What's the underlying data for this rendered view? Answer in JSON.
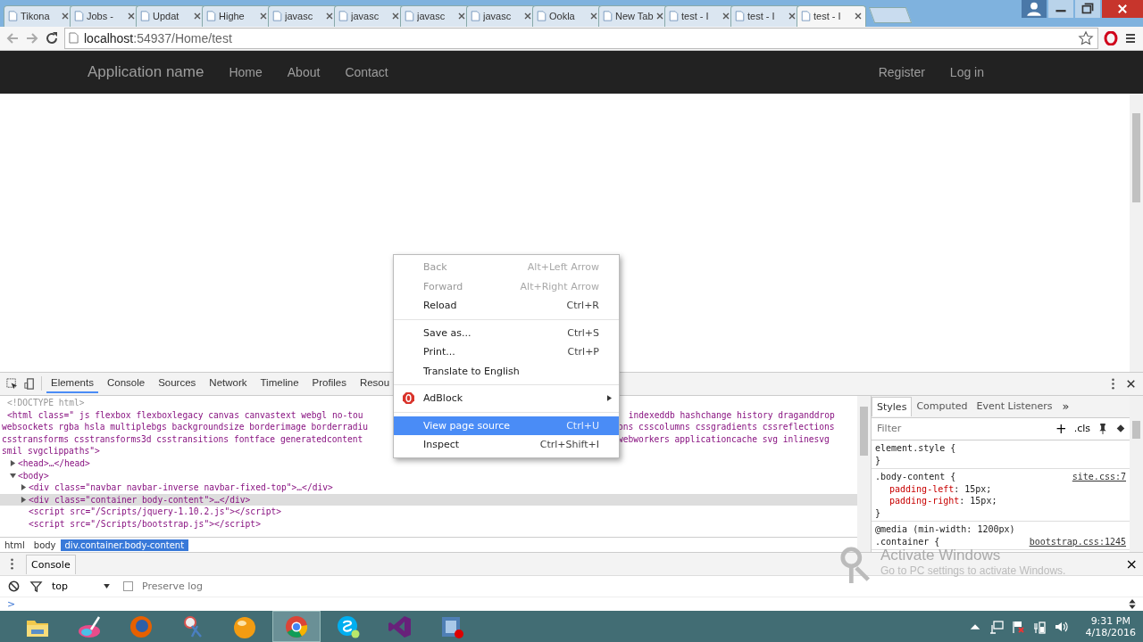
{
  "browser": {
    "tabs": [
      {
        "label": "Tikona",
        "selected": false
      },
      {
        "label": "Jobs -",
        "selected": false
      },
      {
        "label": "Updat",
        "selected": false
      },
      {
        "label": "Highe",
        "selected": false
      },
      {
        "label": "javasc",
        "selected": false
      },
      {
        "label": "javasc",
        "selected": false
      },
      {
        "label": "javasc",
        "selected": false
      },
      {
        "label": "javasc",
        "selected": false
      },
      {
        "label": "Ookla",
        "selected": false
      },
      {
        "label": "New Tab",
        "selected": false
      },
      {
        "label": "test - I",
        "selected": false
      },
      {
        "label": "test - I",
        "selected": false
      },
      {
        "label": "test - I",
        "selected": true
      }
    ],
    "url_host": "localhost",
    "url_path": ":54937/Home/test"
  },
  "page": {
    "brand": "Application name",
    "nav_left": [
      "Home",
      "About",
      "Contact"
    ],
    "nav_right": [
      "Register",
      "Log in"
    ]
  },
  "devtools": {
    "tabs": [
      {
        "label": "Elements",
        "selected": true
      },
      {
        "label": "Console",
        "selected": false
      },
      {
        "label": "Sources",
        "selected": false
      },
      {
        "label": "Network",
        "selected": false
      },
      {
        "label": "Timeline",
        "selected": false
      },
      {
        "label": "Profiles",
        "selected": false
      },
      {
        "label": "Resou",
        "selected": false
      }
    ],
    "dom_tree": [
      {
        "kind": "doctype",
        "selected": false,
        "lines": [
          {
            "text": "<!DOCTYPE html>"
          }
        ]
      },
      {
        "kind": "element",
        "selected": false,
        "lines": [
          {
            "text": "<html class=\" js flexbox flexboxlegacy canvas canvastext webgl no-tou",
            "right": " indexeddb hashchange history draganddrop"
          },
          {
            "text": "websockets rgba hsla multiplebgs backgroundsize borderimage borderradiu",
            "right": "ons csscolumns cssgradients cssreflections"
          },
          {
            "text": "csstransforms csstransforms3d csstransitions fontface generatedcontent",
            "right": "webworkers applicationcache svg inlinesvg"
          },
          {
            "text": "smil svgclippaths\">"
          }
        ],
        "children": [
          {
            "kind": "element",
            "selected": false,
            "expanded": false,
            "lines": [
              {
                "text": "<head>…</head>"
              }
            ]
          },
          {
            "kind": "element",
            "selected": false,
            "expanded": true,
            "lines": [
              {
                "text": "<body>"
              }
            ],
            "children": [
              {
                "kind": "element",
                "selected": false,
                "expanded": false,
                "lines": [
                  {
                    "text": "<div class=\"navbar navbar-inverse navbar-fixed-top\">…</div>"
                  }
                ]
              },
              {
                "kind": "element",
                "selected": true,
                "expanded": false,
                "lines": [
                  {
                    "text": "<div class=\"container body-content\">…</div>"
                  }
                ]
              },
              {
                "kind": "element",
                "selected": false,
                "lines": [
                  {
                    "text": "<script src=\"/Scripts/jquery-1.10.2.js\"></script>"
                  }
                ]
              },
              {
                "kind": "element",
                "selected": false,
                "lines": [
                  {
                    "text": "<script src=\"/Scripts/bootstrap.js\"></script>"
                  }
                ]
              }
            ]
          }
        ]
      }
    ],
    "breadcrumbs": [
      {
        "label": "html",
        "selected": false
      },
      {
        "label": "body",
        "selected": false
      },
      {
        "label": "div.container.body-content",
        "selected": true
      }
    ],
    "side_tabs": [
      {
        "label": "Styles",
        "selected": true
      },
      {
        "label": "Computed",
        "selected": false
      },
      {
        "label": "Event Listeners",
        "selected": false
      }
    ],
    "side_more": "»",
    "filter": {
      "placeholder": "Filter"
    },
    "add": "+",
    "cls": ".cls",
    "rules": [
      {
        "selector": "element.style {",
        "close": "}"
      },
      {
        "selector": ".body-content {",
        "source": "site.css:7",
        "close": "}",
        "declarations": [
          {
            "property": "padding-left",
            "value": ": 15px;"
          },
          {
            "property": "padding-right",
            "value": ": 15px;"
          }
        ]
      },
      {
        "media": "@media (min-width: 1200px)",
        "selector": ".container {",
        "source": "bootstrap.css:1245"
      }
    ],
    "drawer_tab": "Console",
    "close": "×",
    "context": "top",
    "preserve_log": {
      "label": "Preserve log",
      "checked": false
    },
    "prompt": ">"
  },
  "context_menu": [
    {
      "kind": "item",
      "label": "Back",
      "shortcut": "Alt+Left Arrow",
      "disabled": true,
      "selected": false
    },
    {
      "kind": "item",
      "label": "Forward",
      "shortcut": "Alt+Right Arrow",
      "disabled": true,
      "selected": false
    },
    {
      "kind": "item",
      "label": "Reload",
      "shortcut": "Ctrl+R",
      "disabled": false,
      "selected": false
    },
    {
      "kind": "separator"
    },
    {
      "kind": "item",
      "label": "Save as...",
      "shortcut": "Ctrl+S",
      "disabled": false,
      "selected": false
    },
    {
      "kind": "item",
      "label": "Print...",
      "shortcut": "Ctrl+P",
      "disabled": false,
      "selected": false
    },
    {
      "kind": "item",
      "label": "Translate to English",
      "disabled": false,
      "selected": false
    },
    {
      "kind": "separator"
    },
    {
      "kind": "extension",
      "label": "AdBlock",
      "disabled": false,
      "selected": false
    },
    {
      "kind": "separator"
    },
    {
      "kind": "item",
      "label": "View page source",
      "shortcut": "Ctrl+U",
      "disabled": false,
      "selected": true
    },
    {
      "kind": "item",
      "label": "Inspect",
      "shortcut": "Ctrl+Shift+I",
      "disabled": false,
      "selected": false
    }
  ],
  "activation": {
    "title": "Activate Windows",
    "text": "Go to PC settings to activate Windows."
  },
  "taskbar": {
    "apps": [
      {
        "kind": "folder",
        "selected": false
      },
      {
        "kind": "paint",
        "selected": false
      },
      {
        "kind": "firefox",
        "selected": false
      },
      {
        "kind": "scissors",
        "selected": false
      },
      {
        "kind": "ball",
        "selected": false
      },
      {
        "kind": "chrome",
        "selected": true
      },
      {
        "kind": "skype",
        "selected": false
      },
      {
        "kind": "studio",
        "selected": false
      },
      {
        "kind": "media",
        "selected": false
      }
    ],
    "time": "9:31 PM",
    "date": "4/18/2016"
  }
}
